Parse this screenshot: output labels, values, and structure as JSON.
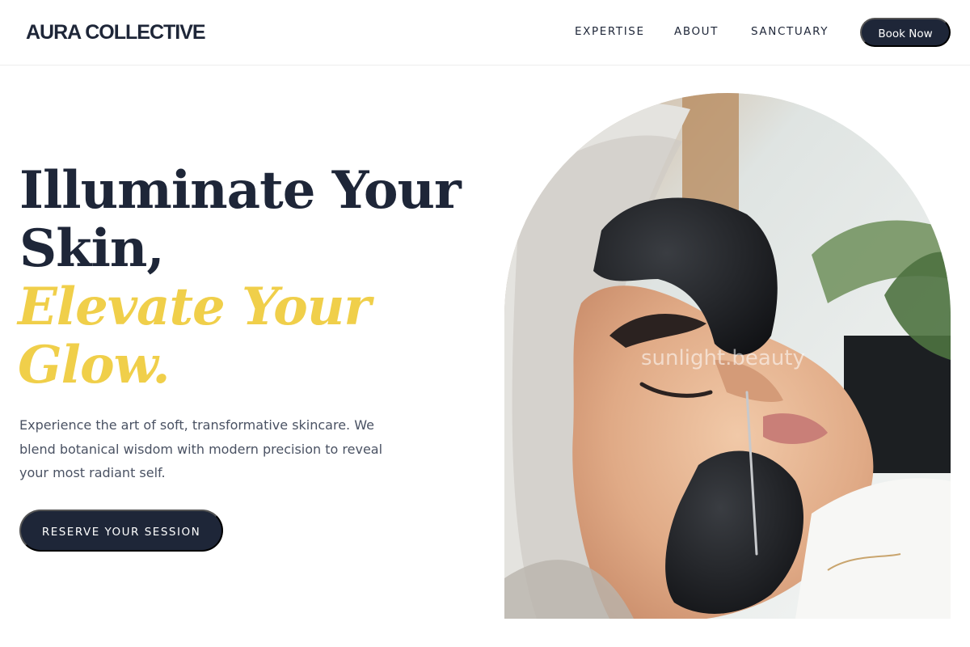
{
  "header": {
    "logo": "AURA COLLECTIVE",
    "nav": [
      {
        "label": "EXPERTISE"
      },
      {
        "label": "ABOUT"
      },
      {
        "label": "SANCTUARY"
      }
    ],
    "cta_label": "Book Now"
  },
  "hero": {
    "title_lines": [
      "Illuminate Your",
      "Skin,"
    ],
    "accent_lines": [
      "Elevate Your",
      "Glow."
    ],
    "description": "Experience the art of soft, transformative skincare. We blend botanical wisdom with modern precision to reveal your most radiant self.",
    "button_label": "RESERVE YOUR SESSION",
    "image_watermark": "sunlight.beauty"
  },
  "colors": {
    "navy": "#1e2638",
    "accent_gold": "#f0cf4a",
    "body_text": "#4a5263"
  }
}
